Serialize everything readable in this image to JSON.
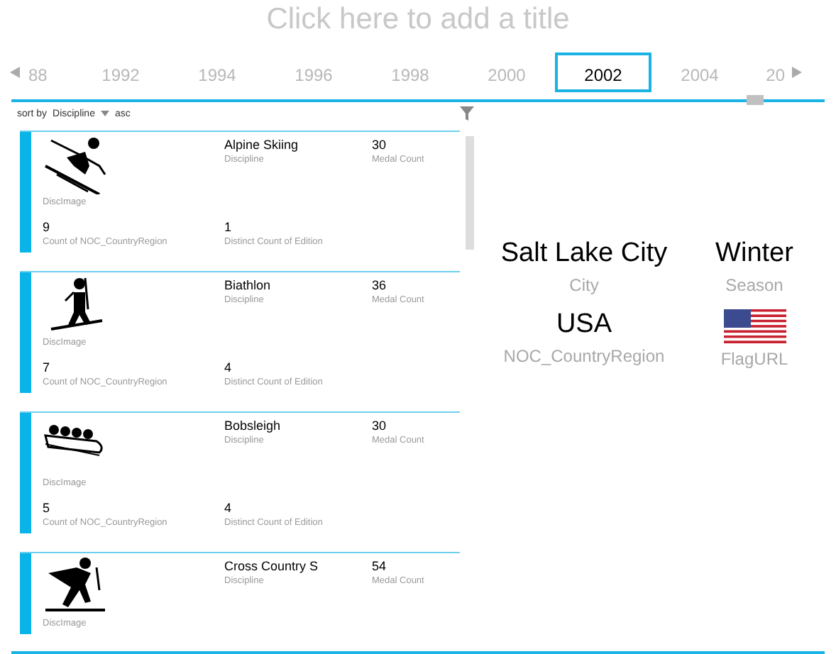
{
  "title": {
    "placeholder": "Click here to add a title"
  },
  "timeline": {
    "years": [
      {
        "label": "88",
        "selected": false
      },
      {
        "label": "1992",
        "selected": false
      },
      {
        "label": "1994",
        "selected": false
      },
      {
        "label": "1996",
        "selected": false
      },
      {
        "label": "1998",
        "selected": false
      },
      {
        "label": "2000",
        "selected": false
      },
      {
        "label": "2002",
        "selected": true
      },
      {
        "label": "2004",
        "selected": false
      },
      {
        "label": "20",
        "selected": false
      }
    ]
  },
  "sort": {
    "label": "sort by",
    "field": "Discipline",
    "order": "asc"
  },
  "cards": [
    {
      "kind": "downhill-skier",
      "image_label": "DiscImage",
      "discipline": "Alpine Skiing",
      "discipline_label": "Discipline",
      "medal_count": "30",
      "medal_label": "Medal Count",
      "noc_count": "9",
      "noc_label": "Count of NOC_CountryRegion",
      "edition_count": "1",
      "edition_label": "Distinct Count of Edition"
    },
    {
      "kind": "biathlete",
      "image_label": "DiscImage",
      "discipline": "Biathlon",
      "discipline_label": "Discipline",
      "medal_count": "36",
      "medal_label": "Medal Count",
      "noc_count": "7",
      "noc_label": "Count of NOC_CountryRegion",
      "edition_count": "4",
      "edition_label": "Distinct Count of Edition"
    },
    {
      "kind": "bobsleigh",
      "image_label": "DiscImage",
      "discipline": "Bobsleigh",
      "discipline_label": "Discipline",
      "medal_count": "30",
      "medal_label": "Medal Count",
      "noc_count": "5",
      "noc_label": "Count of NOC_CountryRegion",
      "edition_count": "4",
      "edition_label": "Distinct Count of Edition"
    },
    {
      "kind": "cross-country-skier",
      "image_label": "DiscImage",
      "discipline": "Cross Country S",
      "discipline_label": "Discipline",
      "medal_count": "54",
      "medal_label": "Medal Count"
    }
  ],
  "details": [
    {
      "kind": "text",
      "value": "Salt Lake City",
      "label": "City"
    },
    {
      "kind": "text",
      "value": "Winter",
      "label": "Season"
    },
    {
      "kind": "text",
      "value": "USA",
      "label": "NOC_CountryRegion"
    },
    {
      "kind": "flag",
      "label": "FlagURL"
    }
  ]
}
